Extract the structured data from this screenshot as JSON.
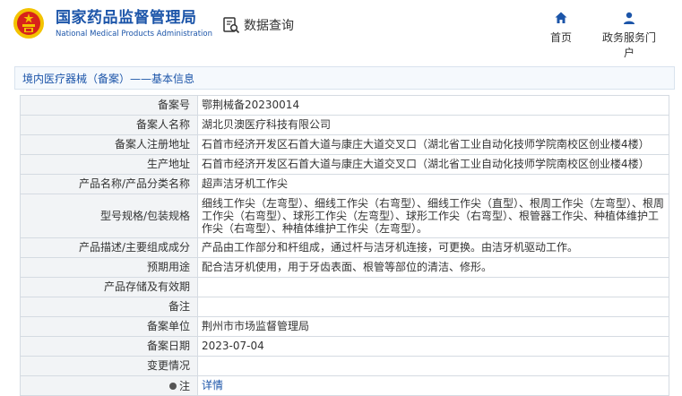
{
  "header": {
    "site_title": "国家药品监督管理局",
    "site_title_en": "National Medical Products Administration",
    "data_query_label": "数据查询",
    "nav": [
      {
        "label": "首页",
        "icon": "home-icon"
      },
      {
        "label": "政务服务门户",
        "icon": "user-icon"
      }
    ]
  },
  "breadcrumb": "境内医疗器械（备案）——基本信息",
  "rows": [
    {
      "label": "备案号",
      "value": "鄂荆械备20230014"
    },
    {
      "label": "备案人名称",
      "value": "湖北贝澳医疗科技有限公司"
    },
    {
      "label": "备案人注册地址",
      "value": "石首市经济开发区石首大道与康庄大道交叉口（湖北省工业自动化技师学院南校区创业楼4楼）"
    },
    {
      "label": "生产地址",
      "value": "石首市经济开发区石首大道与康庄大道交叉口（湖北省工业自动化技师学院南校区创业楼4楼）"
    },
    {
      "label": "产品名称/产品分类名称",
      "value": "超声洁牙机工作尖"
    },
    {
      "label": "型号规格/包装规格",
      "value": "细线工作尖（左弯型）、细线工作尖（右弯型）、细线工作尖（直型）、根周工作尖（左弯型）、根周工作尖（右弯型）、球形工作尖（左弯型）、球形工作尖（右弯型）、根管器工作尖、种植体维护工作尖（右弯型）、种植体维护工作尖（左弯型）。"
    },
    {
      "label": "产品描述/主要组成成分",
      "value": "产品由工作部分和杆组成，通过杆与洁牙机连接，可更换。由洁牙机驱动工作。"
    },
    {
      "label": "预期用途",
      "value": "配合洁牙机使用，用于牙齿表面、根管等部位的清洁、修形。"
    },
    {
      "label": "产品存储及有效期",
      "value": ""
    },
    {
      "label": "备注",
      "value": ""
    },
    {
      "label": "备案单位",
      "value": "荆州市市场监督管理局"
    },
    {
      "label": "备案日期",
      "value": "2023-07-04"
    },
    {
      "label": "变更情况",
      "value": ""
    }
  ],
  "note_row": {
    "label": "注",
    "link": "详情"
  },
  "colors": {
    "brand_blue": "#1c55a9",
    "emblem_red": "#d7231b",
    "emblem_gold": "#f3c300"
  }
}
